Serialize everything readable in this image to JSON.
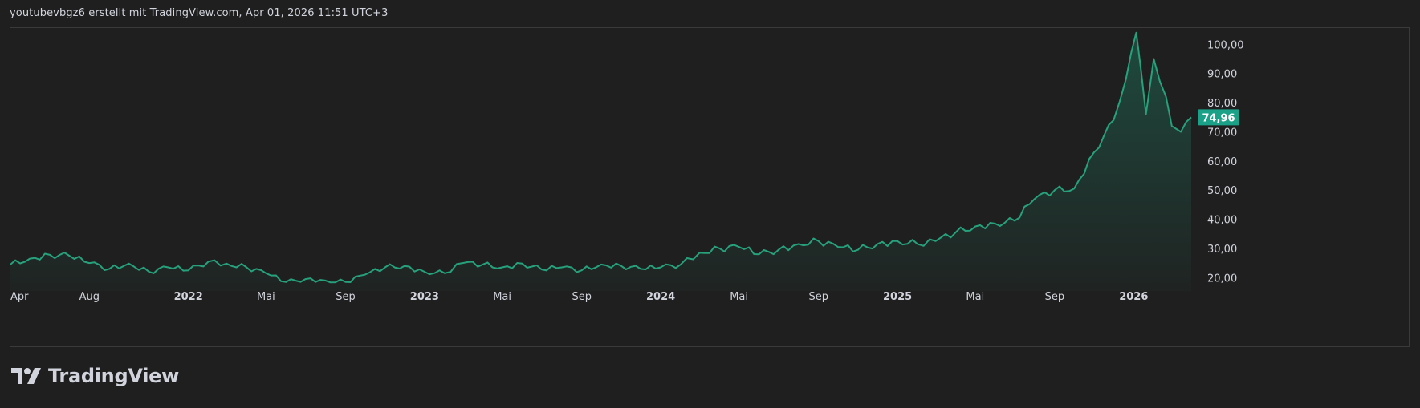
{
  "header": {
    "attribution": "youtubevbgz6 erstellt mit TradingView.com, Apr 01, 2026 11:51 UTC+3"
  },
  "footer": {
    "brand": "TradingView",
    "logo_icon": "tradingview-logo-icon"
  },
  "colors": {
    "background": "#1f1f1f",
    "line": "#26a17b",
    "price_badge": "#1aa187",
    "text": "#d1d4dc",
    "frame": "#3a3a3a"
  },
  "chart_data": {
    "type": "area",
    "x_tick_labels": [
      "Apr",
      "Aug",
      "2022",
      "Mai",
      "Sep",
      "2023",
      "Mai",
      "Sep",
      "2024",
      "Mai",
      "Sep",
      "2025",
      "Mai",
      "Sep",
      "2026"
    ],
    "y_tick_labels": [
      "100,00",
      "90,00",
      "80,00",
      "70,00",
      "60,00",
      "50,00",
      "40,00",
      "30,00",
      "20,00"
    ],
    "y_ticks": [
      100,
      90,
      80,
      70,
      60,
      50,
      40,
      30,
      20
    ],
    "ylim": [
      15.4,
      105.6
    ],
    "last_price": 74.96,
    "last_price_label": "74,96",
    "grid": false,
    "series": [
      {
        "x": [
          "2021-04-01",
          "2021-05-01",
          "2021-06-01",
          "2021-07-01",
          "2021-08-01",
          "2021-09-01",
          "2021-10-01",
          "2021-11-01",
          "2021-12-01",
          "2022-01-01",
          "2022-02-01",
          "2022-03-01",
          "2022-04-01",
          "2022-05-01",
          "2022-06-01",
          "2022-07-01",
          "2022-08-01",
          "2022-09-01",
          "2022-10-01",
          "2022-11-01",
          "2022-12-01",
          "2023-01-01",
          "2023-02-01",
          "2023-03-01",
          "2023-04-01",
          "2023-05-01",
          "2023-06-01",
          "2023-07-01",
          "2023-08-01",
          "2023-09-01",
          "2023-10-01",
          "2023-11-01",
          "2023-12-01",
          "2024-01-01",
          "2024-02-01",
          "2024-03-01",
          "2024-04-01",
          "2024-05-01",
          "2024-06-01",
          "2024-07-01",
          "2024-08-01",
          "2024-09-01",
          "2024-10-01",
          "2024-11-01",
          "2024-12-01",
          "2025-01-01",
          "2025-02-01",
          "2025-03-01",
          "2025-04-01",
          "2025-05-01",
          "2025-06-01",
          "2025-07-01",
          "2025-08-01",
          "2025-09-01",
          "2025-10-01",
          "2025-11-01",
          "2025-12-01",
          "2025-12-20",
          "2026-01-05",
          "2026-01-20",
          "2026-02-01",
          "2026-02-20",
          "2026-03-01",
          "2026-03-15",
          "2026-03-31"
        ],
        "values": [
          24.5,
          26.5,
          27.8,
          27.5,
          25,
          23,
          24.8,
          22,
          23.5,
          22.5,
          25.5,
          24.8,
          23.5,
          21.5,
          18.5,
          19.5,
          19,
          18.5,
          21,
          23.5,
          24,
          22,
          21.5,
          25,
          24.5,
          23.5,
          24.8,
          22.8,
          23.5,
          22.5,
          24.5,
          24,
          23,
          23.5,
          24.5,
          28.5,
          30,
          30.5,
          28,
          29.5,
          31.5,
          32.5,
          30.5,
          29.5,
          31.5,
          32.5,
          31.5,
          32.5,
          35.5,
          37.5,
          38.5,
          39.5,
          47,
          50,
          50.5,
          63,
          74,
          88,
          104,
          76,
          95,
          82,
          72,
          70,
          74.96
        ]
      }
    ]
  }
}
